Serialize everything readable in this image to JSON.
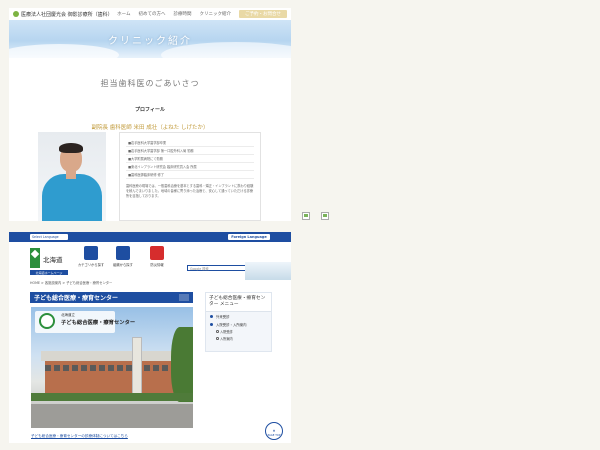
{
  "clinic": {
    "logo_text": "医療法人社団慶光会 御影診療所（歯科）",
    "nav": [
      "ホーム",
      "初めての方へ",
      "診療時間",
      "クリニック紹介"
    ],
    "cta": "ご予約・お問合せ",
    "hero_title": "クリニック紹介",
    "heading": "担当歯科医のごあいさつ",
    "profile_label": "プロフィール",
    "doctor_name": "副院長 歯科医師 米田 成壮（よねた しげたか）",
    "profile_rows": [
      "■岩手医科大学歯学部卒業",
      "■岩手医科大学歯学部 第一口腔外科入局 勤務",
      "■大学附属病院にて勤務",
      "■東北インプラント研究会 臨床研究員入会 所属",
      "■歯科医師臨床研修 修了"
    ],
    "greeting_text": "歯科医療の現場では、一般歯科治療を基本とする歯科・矯正・インプラントに携わり経験を積んでまいりました。地域の皆様に寄り添った治療と、安心して通っていただける診療所を目指しております。"
  },
  "hokkaido": {
    "lang_select": "Select Language",
    "foreign_language": "Foreign Language",
    "logo_text": "北海道",
    "pref_badge": "北海道ホームページ",
    "nav_icons": [
      {
        "label": "カテゴリから探す",
        "icon": "tag-icon",
        "color": "#1e4ea1"
      },
      {
        "label": "組織から探す",
        "icon": "org-icon",
        "color": "#1e4ea1"
      },
      {
        "label": "防災情報",
        "icon": "megaphone-icon",
        "color": "#d62d2d"
      }
    ],
    "search_placeholder": "Google 検索",
    "search_button": "検索",
    "breadcrumb": "HOME > 各施設案内 > 子ども総合医療・療育センター",
    "page_title": "子ども総合医療・療育センター",
    "photo_sign_small": "北海道立",
    "photo_sign_big": "子ども総合医療・療育センター",
    "caption": "子ども総合医療・療育センターの診療体制についてはこちら",
    "side_title": "子ども総合医療・療育センター メニュー",
    "side_items": [
      "外来受診",
      "入院受診・入所案内"
    ],
    "side_sub_items": [
      "入院受診",
      "入所案内"
    ],
    "page_top": "PAGE TOP"
  }
}
